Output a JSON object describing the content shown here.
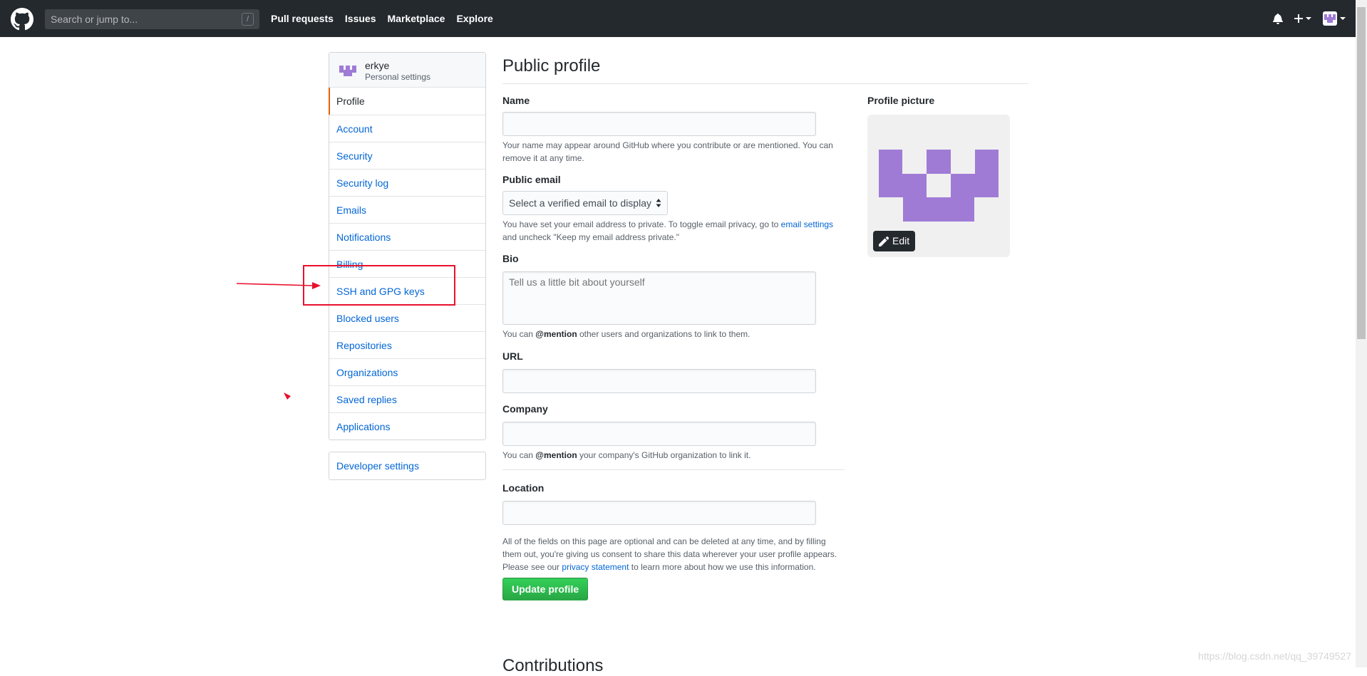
{
  "header": {
    "search_placeholder": "Search or jump to...",
    "search_shortcut": "/",
    "nav": [
      "Pull requests",
      "Issues",
      "Marketplace",
      "Explore"
    ]
  },
  "sidebar": {
    "username": "erkye",
    "subtitle": "Personal settings",
    "items": [
      {
        "label": "Profile"
      },
      {
        "label": "Account"
      },
      {
        "label": "Security"
      },
      {
        "label": "Security log"
      },
      {
        "label": "Emails"
      },
      {
        "label": "Notifications"
      },
      {
        "label": "Billing"
      },
      {
        "label": "SSH and GPG keys"
      },
      {
        "label": "Blocked users"
      },
      {
        "label": "Repositories"
      },
      {
        "label": "Organizations"
      },
      {
        "label": "Saved replies"
      },
      {
        "label": "Applications"
      }
    ],
    "developer_settings": "Developer settings",
    "active_color": "#e36209"
  },
  "main": {
    "title": "Public profile",
    "name": {
      "label": "Name",
      "value": "",
      "note": "Your name may appear around GitHub where you contribute or are mentioned. You can remove it at any time."
    },
    "email": {
      "label": "Public email",
      "selected": "Select a verified email to display",
      "note_pre": "You have set your email address to private. To toggle email privacy, go to",
      "note_link": "email settings",
      "note_post": "and uncheck \"Keep my email address private.\""
    },
    "bio": {
      "label": "Bio",
      "placeholder": "Tell us a little bit about yourself",
      "note_pre": "You can",
      "note_mention": "@mention",
      "note_post": "other users and organizations to link to them."
    },
    "url": {
      "label": "URL",
      "value": ""
    },
    "company": {
      "label": "Company",
      "value": "",
      "note_pre": "You can",
      "note_mention": "@mention",
      "note_post": "your company's GitHub organization to link it."
    },
    "location": {
      "label": "Location",
      "value": ""
    },
    "footer_note_pre": "All of the fields on this page are optional and can be deleted at any time, and by filling them out, you're giving us consent to share this data wherever your user profile appears. Please see our",
    "footer_note_link": "privacy statement",
    "footer_note_post": "to learn more about how we use this information.",
    "update_button": "Update profile",
    "next_section": "Contributions"
  },
  "picture": {
    "label": "Profile picture",
    "edit": "Edit",
    "identicon_color": "#a07bd6"
  },
  "watermark": "https://blog.csdn.net/qq_39749527",
  "colors": {
    "header_bg": "#24292e",
    "link": "#0366d6",
    "primary_button": "#28a745",
    "annotation": "#e8112d"
  }
}
